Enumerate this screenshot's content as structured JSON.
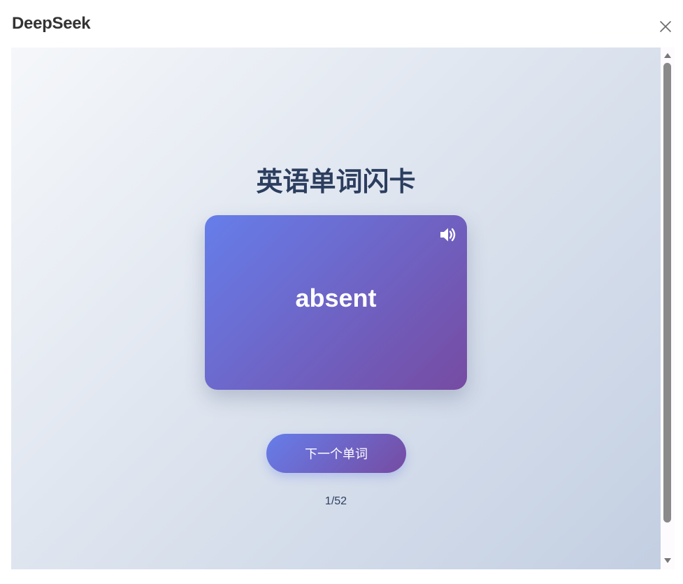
{
  "window": {
    "title": "DeepSeek",
    "close_icon": "close-icon"
  },
  "app": {
    "heading": "英语单词闪卡",
    "card": {
      "word": "absent",
      "speaker_icon": "speaker-icon"
    },
    "next_button_label": "下一个单词",
    "progress": "1/52"
  },
  "scrollbar": {
    "up_icon": "scroll-up-arrow-icon",
    "down_icon": "scroll-down-arrow-icon"
  },
  "colors": {
    "background_gradient_start": "#f5f7fa",
    "background_gradient_end": "#c3cfe2",
    "card_gradient_start": "#667eea",
    "card_gradient_end": "#764ba2",
    "heading_text": "#2c3e5f"
  }
}
